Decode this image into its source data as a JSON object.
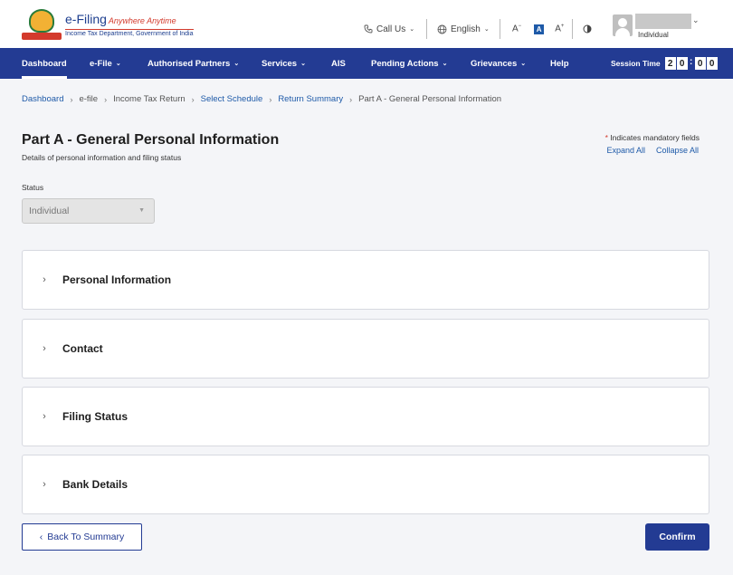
{
  "header": {
    "logo_title": "e-Filing",
    "logo_tagline": "Anywhere Anytime",
    "logo_subtitle": "Income Tax Department, Government of India",
    "call_us": "Call Us",
    "language": "English",
    "font_decrease": "A",
    "font_normal": "A",
    "font_increase": "A",
    "user_role": "Individual"
  },
  "nav": {
    "items": [
      {
        "label": "Dashboard",
        "caret": false,
        "active": true
      },
      {
        "label": "e-File",
        "caret": true
      },
      {
        "label": "Authorised Partners",
        "caret": true
      },
      {
        "label": "Services",
        "caret": true
      },
      {
        "label": "AIS",
        "caret": false
      },
      {
        "label": "Pending Actions",
        "caret": true
      },
      {
        "label": "Grievances",
        "caret": true
      },
      {
        "label": "Help",
        "caret": false
      }
    ],
    "session_label": "Session Time",
    "session_digits": [
      "2",
      "0",
      "0",
      "0"
    ]
  },
  "breadcrumb": [
    {
      "label": "Dashboard",
      "link": true
    },
    {
      "label": "e-file",
      "link": false
    },
    {
      "label": "Income Tax Return",
      "link": false
    },
    {
      "label": "Select Schedule",
      "link": true
    },
    {
      "label": "Return Summary",
      "link": true
    },
    {
      "label": "Part A - General Personal Information",
      "link": false
    }
  ],
  "page": {
    "title": "Part A - General Personal Information",
    "subtitle": "Details of personal information and filing status",
    "mandatory_note": "Indicates mandatory fields",
    "expand_all": "Expand All",
    "collapse_all": "Collapse All"
  },
  "status": {
    "label": "Status",
    "value": "Individual"
  },
  "sections": [
    {
      "title": "Personal Information"
    },
    {
      "title": "Contact"
    },
    {
      "title": "Filing Status"
    },
    {
      "title": "Bank Details"
    }
  ],
  "actions": {
    "back": "Back To Summary",
    "confirm": "Confirm"
  },
  "colors": {
    "primary": "#233b93",
    "link": "#1e5aa8",
    "background": "#f4f5f8"
  }
}
